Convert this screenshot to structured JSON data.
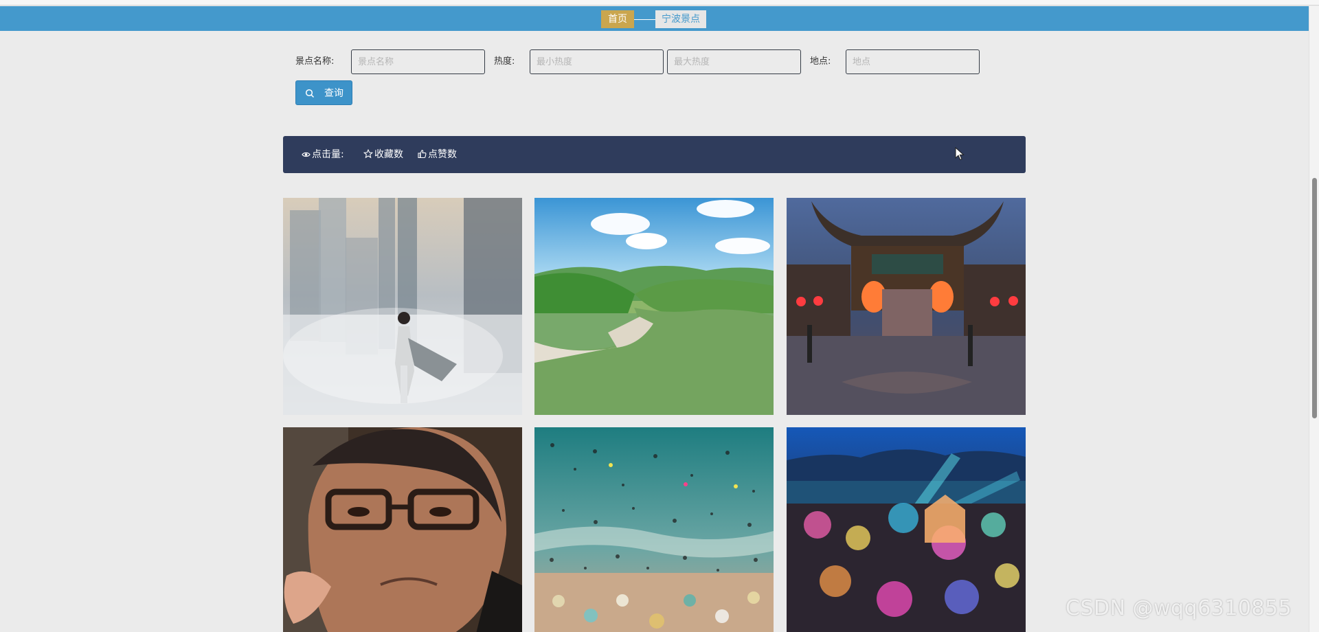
{
  "breadcrumb": {
    "home": "首页",
    "current": "宁波景点"
  },
  "search": {
    "name_label": "景点名称:",
    "name_placeholder": "景点名称",
    "name_value": "",
    "heat_label": "热度:",
    "min_heat_placeholder": "最小热度",
    "min_heat_value": "",
    "max_heat_placeholder": "最大热度",
    "max_heat_value": "",
    "location_label": "地点:",
    "location_placeholder": "地点",
    "location_value": "",
    "query_button": "查询"
  },
  "sort": {
    "clicks": "点击量:",
    "favorites": "收藏数",
    "likes": "点赞数"
  },
  "cards": [
    {
      "scene": "misty-city-person"
    },
    {
      "scene": "green-hills-lake"
    },
    {
      "scene": "night-chinese-gate"
    },
    {
      "scene": "man-with-glasses"
    },
    {
      "scene": "crowded-beach"
    },
    {
      "scene": "night-light-park"
    }
  ],
  "watermark": "CSDN @wqq6310855",
  "colors": {
    "nav": "#4499cc",
    "home_crumb": "#caa64e",
    "sort_bar": "#2f3c5c",
    "query_button": "#3d93c9"
  }
}
